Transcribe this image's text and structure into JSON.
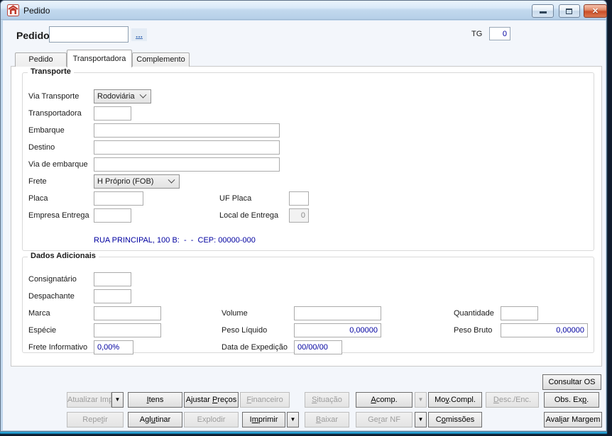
{
  "window": {
    "title": "Pedido"
  },
  "header": {
    "pedido_label": "Pedido",
    "pedido_value": "",
    "lookup_label": "...",
    "tg_label": "TG",
    "tg_value": "0"
  },
  "tabs": {
    "pedido": "Pedido",
    "transportadora": "Transportadora",
    "complemento": "Complemento"
  },
  "transporte": {
    "legend": "Transporte",
    "via_transporte_label": "Via Transporte",
    "via_transporte_value": "Rodoviária",
    "transportadora_label": "Transportadora",
    "transportadora_value": "",
    "embarque_label": "Embarque",
    "embarque_value": "",
    "destino_label": "Destino",
    "destino_value": "",
    "via_embarque_label": "Via de embarque",
    "via_embarque_value": "",
    "frete_label": "Frete",
    "frete_value": "H Próprio (FOB)",
    "placa_label": "Placa",
    "placa_value": "",
    "uf_placa_label": "UF Placa",
    "uf_placa_value": "",
    "empresa_entrega_label": "Empresa Entrega",
    "empresa_entrega_value": "",
    "local_entrega_label": "Local de Entrega",
    "local_entrega_value": "0",
    "endereco": "RUA PRINCIPAL, 100 B:  -  -  CEP: 00000-000"
  },
  "dados_adicionais": {
    "legend": "Dados Adicionais",
    "consignatario_label": "Consignatário",
    "consignatario_value": "",
    "despachante_label": "Despachante",
    "despachante_value": "",
    "marca_label": "Marca",
    "marca_value": "",
    "volume_label": "Volume",
    "volume_value": "",
    "quantidade_label": "Quantidade",
    "quantidade_value": "",
    "especie_label": "Espécie",
    "especie_value": "",
    "peso_liquido_label": "Peso Líquido",
    "peso_liquido_value": "0,00000",
    "peso_bruto_label": "Peso Bruto",
    "peso_bruto_value": "0,00000",
    "frete_informativo_label": "Frete Informativo",
    "frete_informativo_value": "0,00%",
    "data_expedicao_label": "Data de Expedição",
    "data_expedicao_value": "00/00/00"
  },
  "actions": {
    "consultar_os": {
      "label": "Consultar OS",
      "enabled": true
    },
    "row1": [
      {
        "label": "Atualizar Imp",
        "underline": -1,
        "enabled": false,
        "arrow": true,
        "arrow_enabled": true
      },
      {
        "label": "Itens",
        "underline": 0,
        "enabled": true
      },
      {
        "label": "Ajustar Preços",
        "underline": 8,
        "enabled": true
      },
      {
        "label": "Financeiro",
        "underline": 0,
        "enabled": false
      },
      {
        "label": "Situação",
        "underline": 0,
        "enabled": false
      },
      {
        "label": "Acomp.",
        "underline": 0,
        "enabled": true,
        "arrow": true,
        "arrow_enabled": false
      },
      {
        "label": "Mov.Compl.",
        "underline": 2,
        "enabled": true
      },
      {
        "label": "Desc./Enc.",
        "underline": 0,
        "enabled": false
      },
      {
        "label": "Obs. Exp.",
        "underline": 7,
        "enabled": true
      }
    ],
    "row2": [
      {
        "label": "Repetir",
        "underline": 4,
        "enabled": false
      },
      {
        "label": "Aglutinar",
        "underline": 3,
        "enabled": true
      },
      {
        "label": "Explodir",
        "underline": -1,
        "enabled": false
      },
      {
        "label": "Imprimir",
        "underline": 1,
        "enabled": true,
        "arrow": true,
        "arrow_enabled": true
      },
      {
        "label": "Baixar",
        "underline": 0,
        "enabled": false
      },
      {
        "label": "Gerar NF",
        "underline": 2,
        "enabled": false,
        "arrow": true,
        "arrow_enabled": true
      },
      {
        "label": "Comissões",
        "underline": 1,
        "enabled": true
      },
      {
        "label": "Avaliar Margem",
        "underline": 4,
        "enabled": true
      }
    ]
  },
  "colors": {
    "value_text": "#0000A0",
    "titlebar_top": "#EBF4FC",
    "close_button": "#CC4F28"
  }
}
